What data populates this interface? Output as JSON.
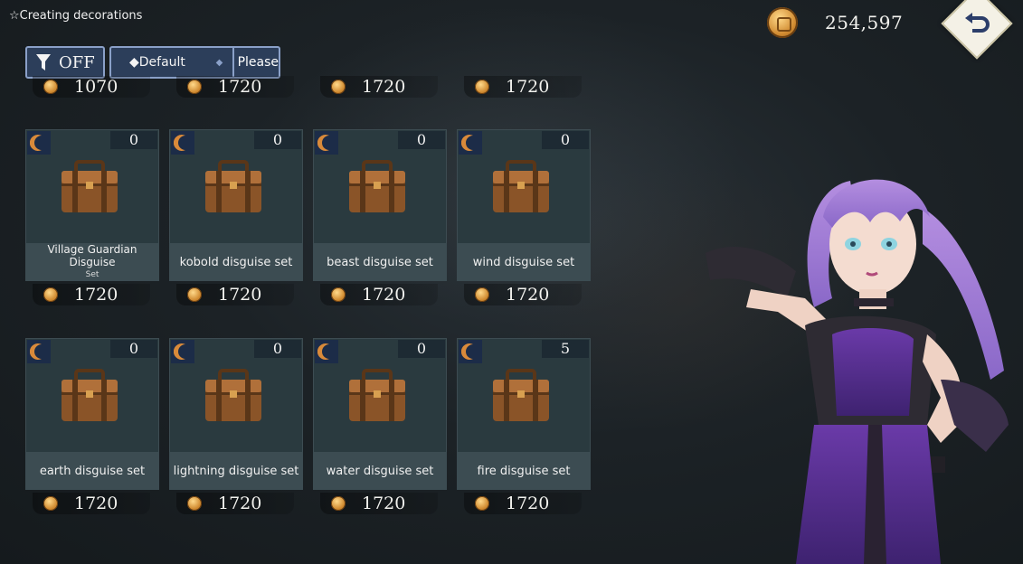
{
  "header": {
    "title": "☆Creating decorations"
  },
  "currency": {
    "icon": "coin-icon",
    "amount": "254,597"
  },
  "toolbar": {
    "filter_label": "OFF",
    "sort_label": "◆Default",
    "sort_arrow": "◆",
    "sort_order_label": "Please"
  },
  "partial_row": {
    "prices": [
      "1070",
      "1720",
      "1720",
      "1720"
    ]
  },
  "items": [
    {
      "name": "Village Guardian Disguise",
      "name_sub": "Set",
      "count": "0",
      "price": "1720"
    },
    {
      "name": "kobold disguise set",
      "count": "0",
      "price": "1720"
    },
    {
      "name": "beast disguise set",
      "count": "0",
      "price": "1720"
    },
    {
      "name": "wind disguise set",
      "count": "0",
      "price": "1720"
    },
    {
      "name": "earth disguise set",
      "count": "0",
      "price": "1720"
    },
    {
      "name": "lightning disguise set",
      "count": "0",
      "price": "1720"
    },
    {
      "name": "water disguise set",
      "count": "0",
      "price": "1720"
    },
    {
      "name": "fire disguise set",
      "count": "5",
      "price": "1720"
    }
  ],
  "colors": {
    "accent": "#8aa0c8",
    "card": "#2a3a3f",
    "moon": "#d98a3a",
    "coin": "#d08a30"
  }
}
